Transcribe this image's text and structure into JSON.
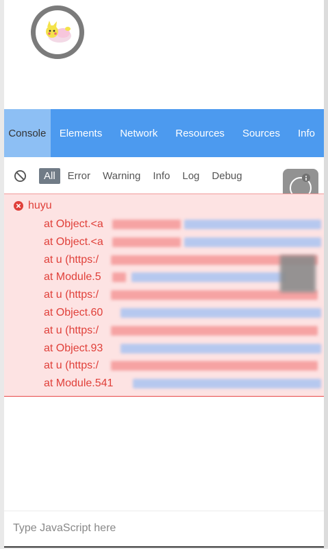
{
  "tabs": [
    {
      "label": "Console",
      "active": true
    },
    {
      "label": "Elements",
      "active": false
    },
    {
      "label": "Network",
      "active": false
    },
    {
      "label": "Resources",
      "active": false
    },
    {
      "label": "Sources",
      "active": false
    },
    {
      "label": "Info",
      "active": false
    }
  ],
  "filters": [
    {
      "label": "All",
      "active": true
    },
    {
      "label": "Error",
      "active": false
    },
    {
      "label": "Warning",
      "active": false
    },
    {
      "label": "Info",
      "active": false
    },
    {
      "label": "Log",
      "active": false
    },
    {
      "label": "Debug",
      "active": false
    }
  ],
  "log": {
    "error_message": "huyu",
    "stack": [
      "at Object.<a",
      "at Object.<a",
      "at u (https:/",
      "at Module.5",
      "at u (https:/",
      "at Object.60",
      "at u (https:/",
      "at Object.93",
      "at u (https:/",
      "at Module.541"
    ]
  },
  "console_input": {
    "placeholder": "Type JavaScript here",
    "value": ""
  },
  "colors": {
    "tab_bar": "#4c9aef",
    "tab_active": "#8dbff4",
    "error_text": "#e0403a",
    "error_bg": "#fde3e3",
    "filter_active": "#707b86"
  },
  "icons": {
    "clear": "block-icon",
    "error": "error-icon",
    "tool": "tool-icon",
    "avatar": "avatar-icon"
  }
}
